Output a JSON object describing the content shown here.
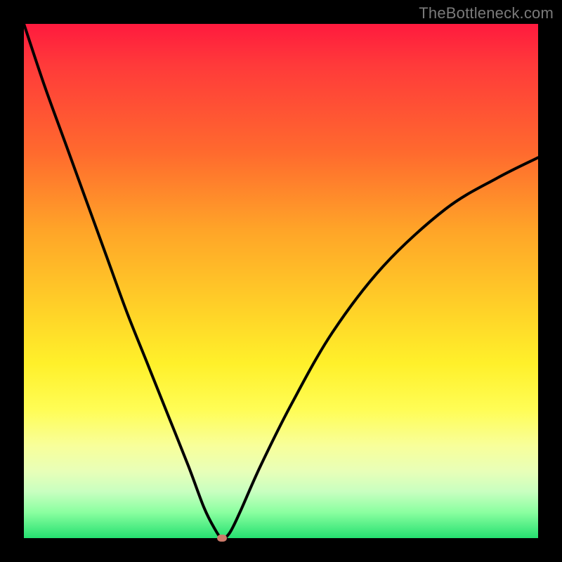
{
  "watermark": "TheBottleneck.com",
  "colors": {
    "frame": "#000000",
    "curve": "#000000",
    "marker": "#cd7a6a",
    "gradient_top": "#ff1a3e",
    "gradient_bottom": "#25e070"
  },
  "chart_data": {
    "type": "line",
    "title": "",
    "xlabel": "",
    "ylabel": "",
    "xlim": [
      0,
      100
    ],
    "ylim": [
      0,
      100
    ],
    "grid": false,
    "legend": false,
    "annotations": [],
    "series": [
      {
        "name": "curve",
        "x": [
          0,
          4,
          8,
          12,
          16,
          20,
          24,
          28,
          32,
          35,
          37,
          38.5,
          40,
          42,
          46,
          52,
          60,
          70,
          82,
          92,
          100
        ],
        "y": [
          100,
          88,
          77,
          66,
          55,
          44,
          34,
          24,
          14,
          6,
          2,
          0,
          1,
          5,
          14,
          26,
          40,
          53,
          64,
          70,
          74
        ]
      }
    ],
    "marker": {
      "x": 38.5,
      "y": 0
    }
  }
}
